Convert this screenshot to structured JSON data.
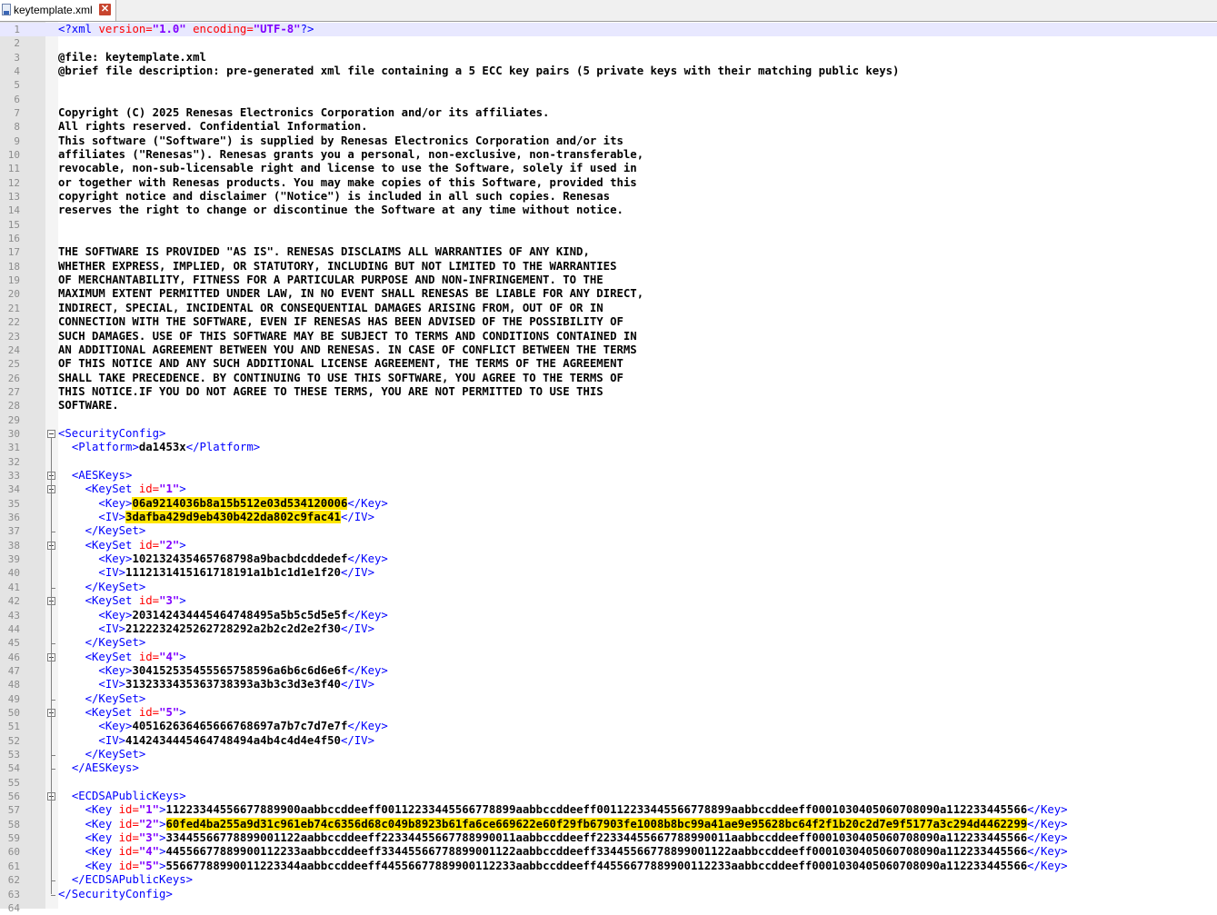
{
  "tab": {
    "filename": "keytemplate.xml"
  },
  "lines": [
    [
      {
        "c": "t",
        "s": "<?xml"
      },
      {
        "s": " "
      },
      {
        "c": "a",
        "s": "version="
      },
      {
        "c": "v",
        "s": "\"1.0\""
      },
      {
        "s": " "
      },
      {
        "c": "a",
        "s": "encoding="
      },
      {
        "c": "v",
        "s": "\"UTF-8\""
      },
      {
        "c": "t",
        "s": "?>"
      }
    ],
    [],
    [
      {
        "s": "@file: keytemplate.xml"
      }
    ],
    [
      {
        "s": "@brief file description: pre-generated xml file containing a 5 ECC key pairs (5 private keys with their matching public keys)"
      }
    ],
    [],
    [],
    [
      {
        "s": "Copyright (C) 2025 Renesas Electronics Corporation and/or its affiliates."
      }
    ],
    [
      {
        "s": "All rights reserved. Confidential Information."
      }
    ],
    [
      {
        "s": "This software (\"Software\") is supplied by Renesas Electronics Corporation and/or its"
      }
    ],
    [
      {
        "s": "affiliates (\"Renesas\"). Renesas grants you a personal, non-exclusive, non-transferable,"
      }
    ],
    [
      {
        "s": "revocable, non-sub-licensable right and license to use the Software, solely if used in"
      }
    ],
    [
      {
        "s": "or together with Renesas products. You may make copies of this Software, provided this"
      }
    ],
    [
      {
        "s": "copyright notice and disclaimer (\"Notice\") is included in all such copies. Renesas"
      }
    ],
    [
      {
        "s": "reserves the right to change or discontinue the Software at any time without notice."
      }
    ],
    [],
    [],
    [
      {
        "s": "THE SOFTWARE IS PROVIDED \"AS IS\". RENESAS DISCLAIMS ALL WARRANTIES OF ANY KIND,"
      }
    ],
    [
      {
        "s": "WHETHER EXPRESS, IMPLIED, OR STATUTORY, INCLUDING BUT NOT LIMITED TO THE WARRANTIES"
      }
    ],
    [
      {
        "s": "OF MERCHANTABILITY, FITNESS FOR A PARTICULAR PURPOSE AND NON-INFRINGEMENT. TO THE"
      }
    ],
    [
      {
        "s": "MAXIMUM EXTENT PERMITTED UNDER LAW, IN NO EVENT SHALL RENESAS BE LIABLE FOR ANY DIRECT,"
      }
    ],
    [
      {
        "s": "INDIRECT, SPECIAL, INCIDENTAL OR CONSEQUENTIAL DAMAGES ARISING FROM, OUT OF OR IN"
      }
    ],
    [
      {
        "s": "CONNECTION WITH THE SOFTWARE, EVEN IF RENESAS HAS BEEN ADVISED OF THE POSSIBILITY OF"
      }
    ],
    [
      {
        "s": "SUCH DAMAGES. USE OF THIS SOFTWARE MAY BE SUBJECT TO TERMS AND CONDITIONS CONTAINED IN"
      }
    ],
    [
      {
        "s": "AN ADDITIONAL AGREEMENT BETWEEN YOU AND RENESAS. IN CASE OF CONFLICT BETWEEN THE TERMS"
      }
    ],
    [
      {
        "s": "OF THIS NOTICE AND ANY SUCH ADDITIONAL LICENSE AGREEMENT, THE TERMS OF THE AGREEMENT"
      }
    ],
    [
      {
        "s": "SHALL TAKE PRECEDENCE. BY CONTINUING TO USE THIS SOFTWARE, YOU AGREE TO THE TERMS OF"
      }
    ],
    [
      {
        "s": "THIS NOTICE.IF YOU DO NOT AGREE TO THESE TERMS, YOU ARE NOT PERMITTED TO USE THIS"
      }
    ],
    [
      {
        "s": "SOFTWARE."
      }
    ],
    [],
    [
      {
        "c": "t",
        "s": "<SecurityConfig>"
      }
    ],
    [
      {
        "s": "  "
      },
      {
        "c": "t",
        "s": "<Platform>"
      },
      {
        "s": "da1453x"
      },
      {
        "c": "t",
        "s": "</Platform>"
      }
    ],
    [],
    [
      {
        "s": "  "
      },
      {
        "c": "t",
        "s": "<AESKeys>"
      }
    ],
    [
      {
        "s": "    "
      },
      {
        "c": "t",
        "s": "<KeySet"
      },
      {
        "s": " "
      },
      {
        "c": "a",
        "s": "id="
      },
      {
        "c": "v",
        "s": "\"1\""
      },
      {
        "c": "t",
        "s": ">"
      }
    ],
    [
      {
        "s": "      "
      },
      {
        "c": "t",
        "s": "<Key>"
      },
      {
        "c": "hl",
        "s": "06a9214036b8a15b512e03d534120006"
      },
      {
        "c": "t",
        "s": "</Key>"
      }
    ],
    [
      {
        "s": "      "
      },
      {
        "c": "t",
        "s": "<IV>"
      },
      {
        "c": "hl",
        "s": "3dafba429d9eb430b422da802c9fac41"
      },
      {
        "c": "t",
        "s": "</IV>"
      }
    ],
    [
      {
        "s": "    "
      },
      {
        "c": "t",
        "s": "</KeySet>"
      }
    ],
    [
      {
        "s": "    "
      },
      {
        "c": "t",
        "s": "<KeySet"
      },
      {
        "s": " "
      },
      {
        "c": "a",
        "s": "id="
      },
      {
        "c": "v",
        "s": "\"2\""
      },
      {
        "c": "t",
        "s": ">"
      }
    ],
    [
      {
        "s": "      "
      },
      {
        "c": "t",
        "s": "<Key>"
      },
      {
        "s": "102132435465768798a9bacbdcddedef"
      },
      {
        "c": "t",
        "s": "</Key>"
      }
    ],
    [
      {
        "s": "      "
      },
      {
        "c": "t",
        "s": "<IV>"
      },
      {
        "s": "1112131415161718191a1b1c1d1e1f20"
      },
      {
        "c": "t",
        "s": "</IV>"
      }
    ],
    [
      {
        "s": "    "
      },
      {
        "c": "t",
        "s": "</KeySet>"
      }
    ],
    [
      {
        "s": "    "
      },
      {
        "c": "t",
        "s": "<KeySet"
      },
      {
        "s": " "
      },
      {
        "c": "a",
        "s": "id="
      },
      {
        "c": "v",
        "s": "\"3\""
      },
      {
        "c": "t",
        "s": ">"
      }
    ],
    [
      {
        "s": "      "
      },
      {
        "c": "t",
        "s": "<Key>"
      },
      {
        "s": "2031424344454647484 95a5b5c5d5e5f"
      },
      {
        "c": "t",
        "s": "</Key>"
      }
    ],
    [
      {
        "s": "      "
      },
      {
        "c": "t",
        "s": "<IV>"
      },
      {
        "s": "2122232425262728292a2b2c2d2e2f30"
      },
      {
        "c": "t",
        "s": "</IV>"
      }
    ],
    [
      {
        "s": "    "
      },
      {
        "c": "t",
        "s": "</KeySet>"
      }
    ],
    [
      {
        "s": "    "
      },
      {
        "c": "t",
        "s": "<KeySet"
      },
      {
        "s": " "
      },
      {
        "c": "a",
        "s": "id="
      },
      {
        "c": "v",
        "s": "\"4\""
      },
      {
        "c": "t",
        "s": ">"
      }
    ],
    [
      {
        "s": "      "
      },
      {
        "c": "t",
        "s": "<Key>"
      },
      {
        "s": "304152535455565758596a6b6c6d6e6f"
      },
      {
        "c": "t",
        "s": "</Key>"
      }
    ],
    [
      {
        "s": "      "
      },
      {
        "c": "t",
        "s": "<IV>"
      },
      {
        "s": "3132333435363738393a3b3c3d3e3f40"
      },
      {
        "c": "t",
        "s": "</IV>"
      }
    ],
    [
      {
        "s": "    "
      },
      {
        "c": "t",
        "s": "</KeySet>"
      }
    ],
    [
      {
        "s": "    "
      },
      {
        "c": "t",
        "s": "<KeySet"
      },
      {
        "s": " "
      },
      {
        "c": "a",
        "s": "id="
      },
      {
        "c": "v",
        "s": "\"5\""
      },
      {
        "c": "t",
        "s": ">"
      }
    ],
    [
      {
        "s": "      "
      },
      {
        "c": "t",
        "s": "<Key>"
      },
      {
        "s": "405162636465666768697a7b7c7d7e7f"
      },
      {
        "c": "t",
        "s": "</Key>"
      }
    ],
    [
      {
        "s": "      "
      },
      {
        "c": "t",
        "s": "<IV>"
      },
      {
        "s": "4142434445464748494a4b4c4d4e4f50"
      },
      {
        "c": "t",
        "s": "</IV>"
      }
    ],
    [
      {
        "s": "    "
      },
      {
        "c": "t",
        "s": "</KeySet>"
      }
    ],
    [
      {
        "s": "  "
      },
      {
        "c": "t",
        "s": "</AESKeys>"
      }
    ],
    [],
    [
      {
        "s": "  "
      },
      {
        "c": "t",
        "s": "<ECDSAPublicKeys>"
      }
    ],
    [
      {
        "s": "    "
      },
      {
        "c": "t",
        "s": "<Key"
      },
      {
        "s": " "
      },
      {
        "c": "a",
        "s": "id="
      },
      {
        "c": "v",
        "s": "\"1\""
      },
      {
        "c": "t",
        "s": ">"
      },
      {
        "s": "11223344556677889900aabbccddeeff00112233445566778899aabbccddeeff00112233445566778899aabbccddeeff000103040506070809 0a112233445566"
      },
      {
        "c": "t",
        "s": "</Key>"
      }
    ],
    [
      {
        "s": "    "
      },
      {
        "c": "t",
        "s": "<Key"
      },
      {
        "s": " "
      },
      {
        "c": "a",
        "s": "id="
      },
      {
        "c": "v",
        "s": "\"2\""
      },
      {
        "c": "t",
        "s": ">"
      },
      {
        "c": "hl",
        "s": "60fed4ba255a9d31c961eb74c6356d68c049b8923b61fa6ce669622e60f29fb67903fe1008b8bc99a41ae9e95628bc64f2f1b20c2d7e9f5177a3c294d4462299"
      },
      {
        "c": "t",
        "s": "</Key>"
      }
    ],
    [
      {
        "s": "    "
      },
      {
        "c": "t",
        "s": "<Key"
      },
      {
        "s": " "
      },
      {
        "c": "a",
        "s": "id="
      },
      {
        "c": "v",
        "s": "\"3\""
      },
      {
        "c": "t",
        "s": ">"
      },
      {
        "s": "33445566778899001122aabbccddeeff22334455667788990011aabbccddeeff22334455667788990011aabbccddeeff000103040506070809 0a112233445566"
      },
      {
        "c": "t",
        "s": "</Key>"
      }
    ],
    [
      {
        "s": "    "
      },
      {
        "c": "t",
        "s": "<Key"
      },
      {
        "s": " "
      },
      {
        "c": "a",
        "s": "id="
      },
      {
        "c": "v",
        "s": "\"4\""
      },
      {
        "c": "t",
        "s": ">"
      },
      {
        "s": "44556677889900112233aabbccddeeff33445566778899001122aabbccddeeff33445566778899001122aabbccddeeff000103040506070809 0a112233445566"
      },
      {
        "c": "t",
        "s": "</Key>"
      }
    ],
    [
      {
        "s": "    "
      },
      {
        "c": "t",
        "s": "<Key"
      },
      {
        "s": " "
      },
      {
        "c": "a",
        "s": "id="
      },
      {
        "c": "v",
        "s": "\"5\""
      },
      {
        "c": "t",
        "s": ">"
      },
      {
        "s": "55667788990011223344aabbccddeeff44556677889900112233aabbccddeeff44556677889900112233aabbccddeeff000103040506070809 0a112233445566"
      },
      {
        "c": "t",
        "s": "</Key>"
      }
    ],
    [
      {
        "s": "  "
      },
      {
        "c": "t",
        "s": "</ECDSAPublicKeys>"
      }
    ],
    [
      {
        "c": "t",
        "s": "</SecurityConfig>"
      }
    ],
    []
  ]
}
